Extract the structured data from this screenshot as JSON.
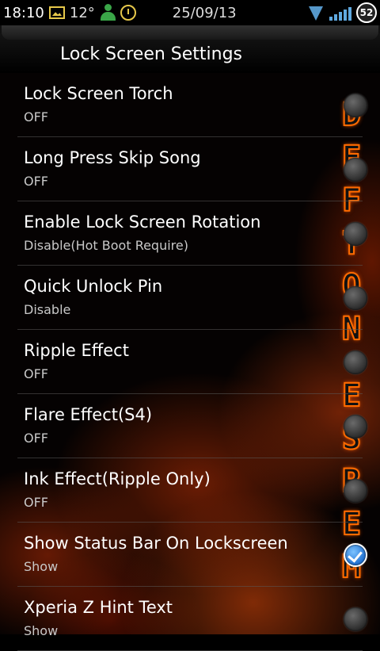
{
  "status_bar": {
    "time": "18:10",
    "temperature": "12°",
    "date": "25/09/13",
    "battery": "52",
    "icons": [
      "image-icon",
      "person-icon",
      "alarm-icon",
      "wifi-icon",
      "signal-icon",
      "battery-icon"
    ]
  },
  "header": {
    "title": "Lock Screen Settings"
  },
  "side_text": "DEFTONES  REDOM",
  "settings": [
    {
      "label": "Lock Screen Torch",
      "summary": "OFF",
      "checked": false
    },
    {
      "label": "Long Press Skip Song",
      "summary": "OFF",
      "checked": false
    },
    {
      "label": "Enable Lock Screen Rotation",
      "summary": "Disable(Hot Boot Require)",
      "checked": false
    },
    {
      "label": "Quick Unlock Pin",
      "summary": "Disable",
      "checked": false
    },
    {
      "label": "Ripple Effect",
      "summary": "OFF",
      "checked": false
    },
    {
      "label": "Flare Effect(S4)",
      "summary": "OFF",
      "checked": false
    },
    {
      "label": "Ink Effect(Ripple Only)",
      "summary": "OFF",
      "checked": false
    },
    {
      "label": "Show Status Bar On Lockscreen",
      "summary": "Show",
      "checked": true
    },
    {
      "label": "Xperia Z Hint Text",
      "summary": "Show",
      "checked": false
    }
  ],
  "colors": {
    "accent": "#ff6a00",
    "checked": "#1e6fd1",
    "summary_text": "#c8c8c8"
  }
}
